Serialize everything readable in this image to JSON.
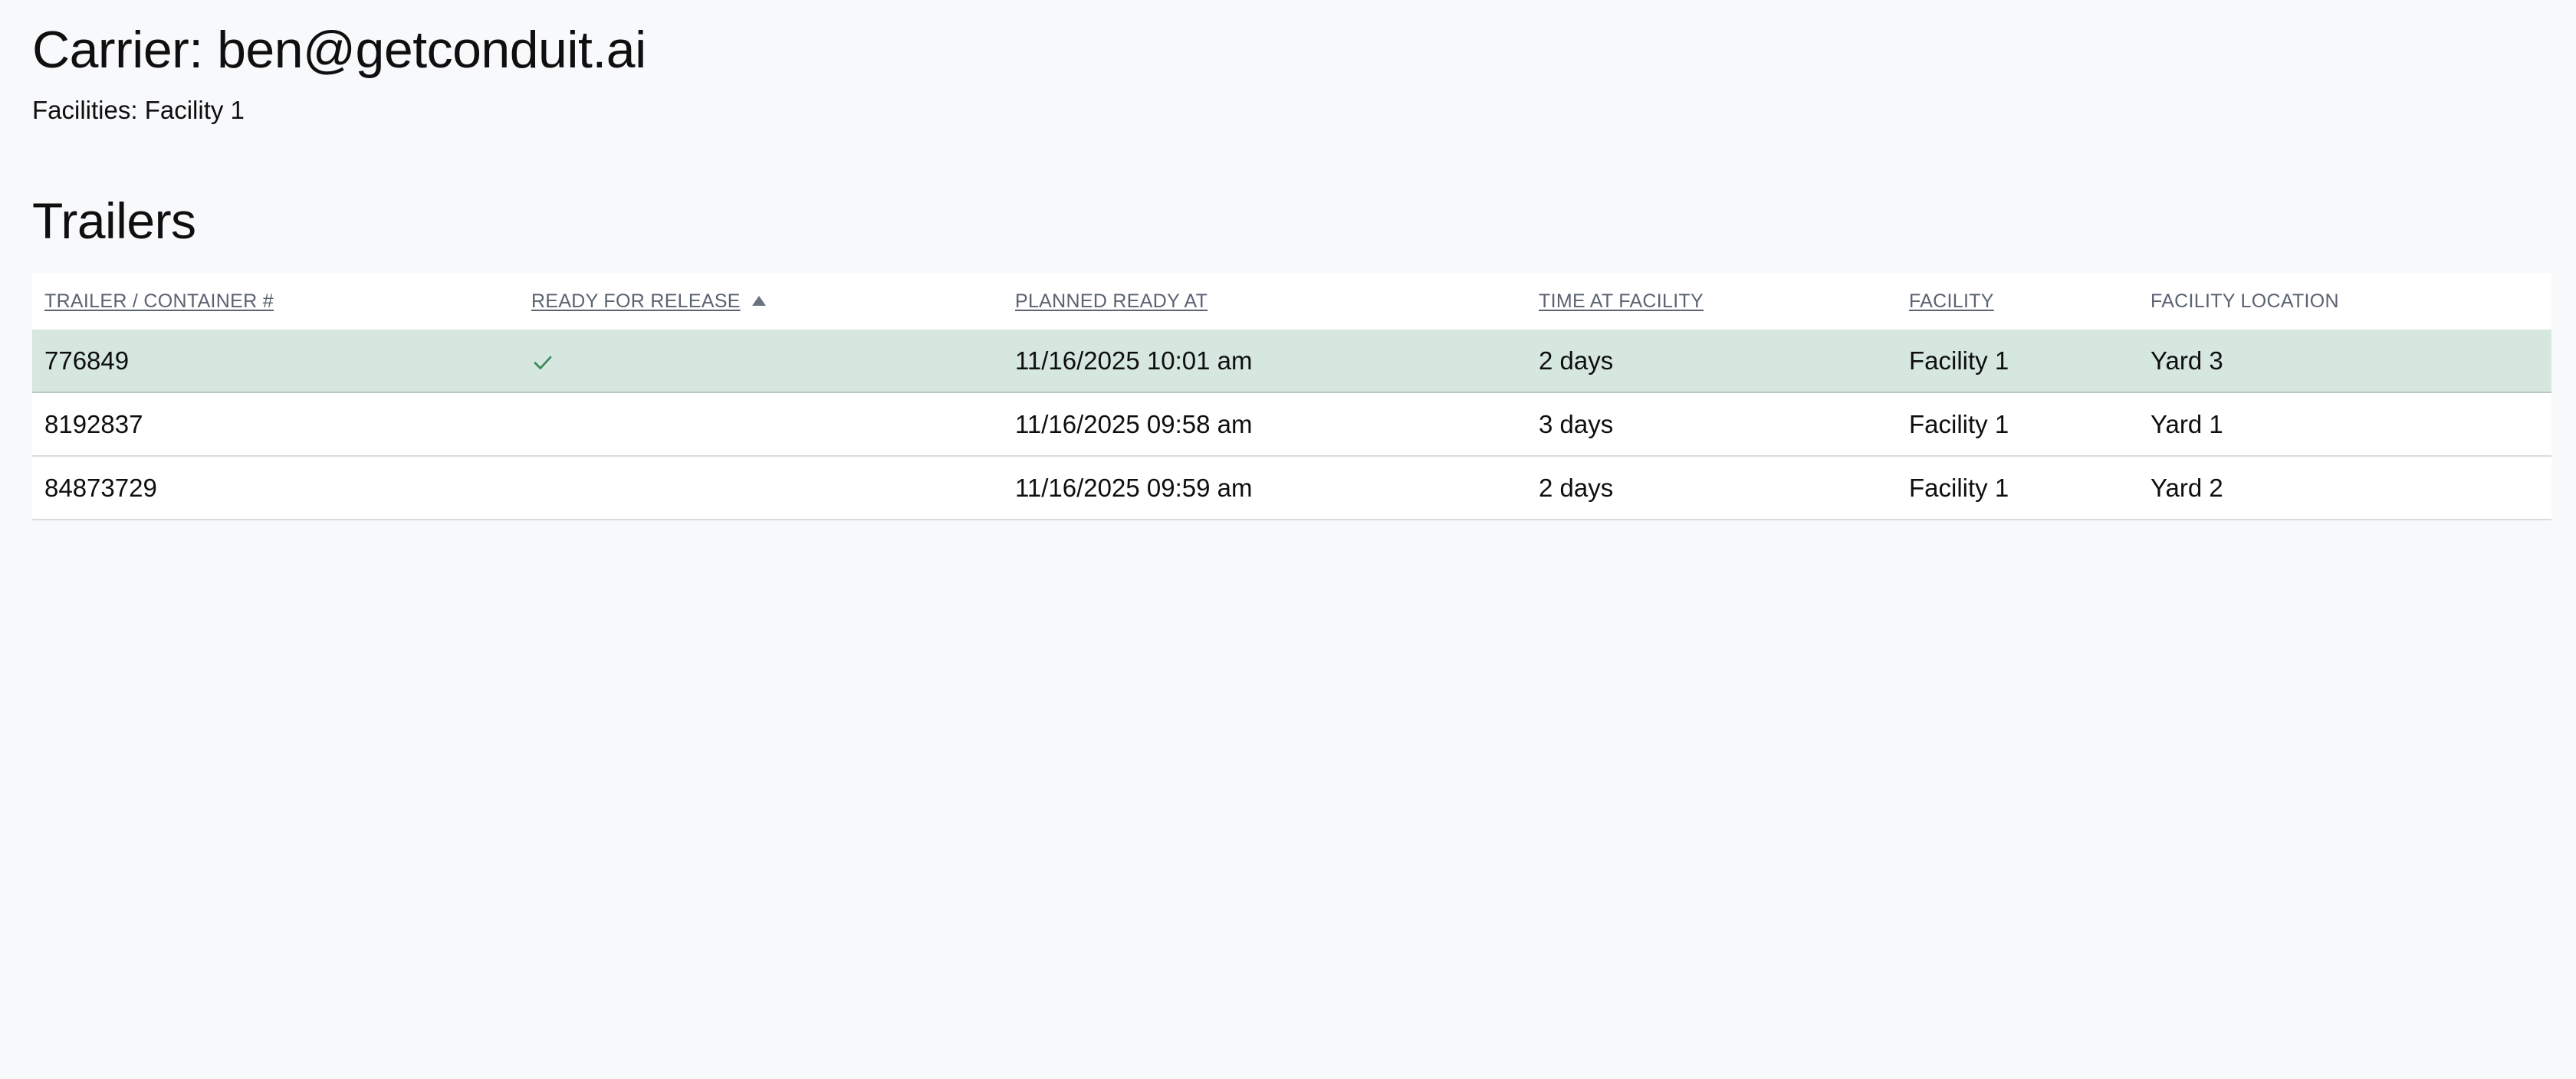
{
  "header": {
    "carrier_title": "Carrier: ben@getconduit.ai",
    "facilities_line": "Facilities: Facility 1"
  },
  "trailers": {
    "section_title": "Trailers",
    "columns": [
      {
        "label": "TRAILER / CONTAINER #",
        "sortable": true
      },
      {
        "label": "READY FOR RELEASE",
        "sortable": true,
        "sorted": "ascending"
      },
      {
        "label": "PLANNED READY AT",
        "sortable": true
      },
      {
        "label": "TIME AT FACILITY",
        "sortable": true
      },
      {
        "label": "FACILITY",
        "sortable": true
      },
      {
        "label": "FACILITY LOCATION",
        "sortable": false
      }
    ],
    "rows": [
      {
        "trailer": "776849",
        "ready_for_release": true,
        "ready_icon": "checkmark-icon",
        "planned_ready_at": "11/16/2025 10:01 am",
        "time_at_facility": "2 days",
        "facility": "Facility 1",
        "location": "Yard 3"
      },
      {
        "trailer": "8192837",
        "ready_for_release": false,
        "planned_ready_at": "11/16/2025 09:58 am",
        "time_at_facility": "3 days",
        "facility": "Facility 1",
        "location": "Yard 1"
      },
      {
        "trailer": "84873729",
        "ready_for_release": false,
        "planned_ready_at": "11/16/2025 09:59 am",
        "time_at_facility": "2 days",
        "facility": "Facility 1",
        "location": "Yard 2"
      }
    ]
  },
  "colors": {
    "page_background": "#f8f9fb",
    "ready_row_background": "#d5e7df",
    "check_color": "#3a8a5c",
    "header_text": "#5b6270"
  }
}
